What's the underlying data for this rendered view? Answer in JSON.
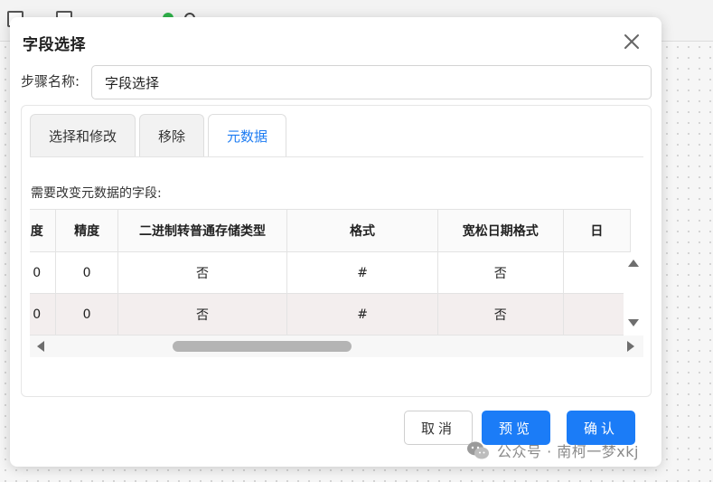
{
  "dialog": {
    "title": "字段选择",
    "step_name_label": "步骤名称:",
    "step_name_value": "字段选择"
  },
  "tabs": [
    {
      "label": "选择和修改",
      "active": false
    },
    {
      "label": "移除",
      "active": false
    },
    {
      "label": "元数据",
      "active": true
    }
  ],
  "section_label": "需要改变元数据的字段:",
  "table": {
    "headers": [
      "度",
      "精度",
      "二进制转普通存储类型",
      "格式",
      "宽松日期格式",
      "日"
    ],
    "rows": [
      [
        "0",
        "0",
        "否",
        "#",
        "否",
        ""
      ],
      [
        "0",
        "0",
        "否",
        "#",
        "否",
        ""
      ]
    ]
  },
  "buttons": {
    "cancel": "取消",
    "preview": "预览",
    "confirm": "确认"
  },
  "watermark": "公众号 · 南柯一梦xkj",
  "colors": {
    "accent": "#1b7cf7",
    "active_tab_text": "#1e7cf2",
    "shaded_row": "#f3eeee"
  },
  "icons": {
    "close": "close-icon",
    "scroll_up": "arrow-up-icon",
    "scroll_down": "arrow-down-icon",
    "scroll_left": "arrow-left-icon",
    "scroll_right": "arrow-right-icon",
    "watermark": "wechat-icon"
  }
}
